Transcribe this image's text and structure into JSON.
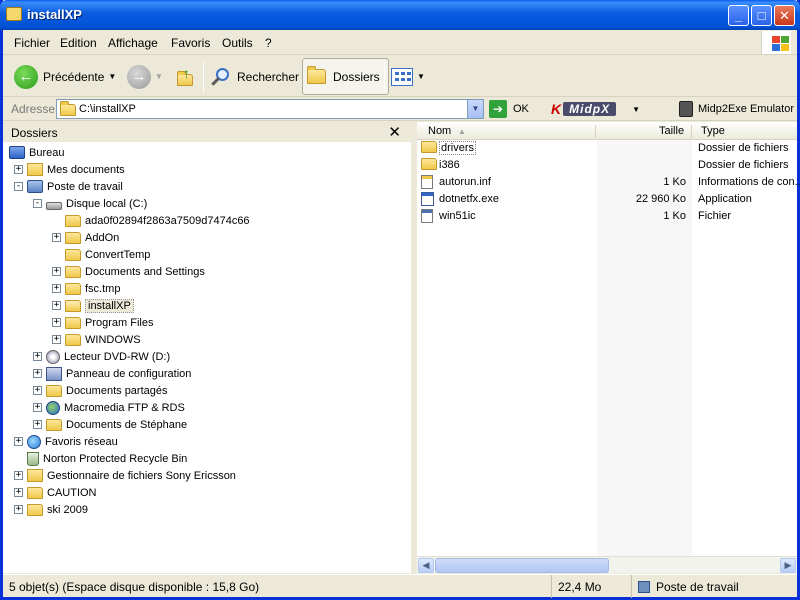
{
  "window": {
    "title": "installXP"
  },
  "menu": [
    "Fichier",
    "Edition",
    "Affichage",
    "Favoris",
    "Outils",
    "?"
  ],
  "toolbar": {
    "back": "Précédente",
    "search": "Rechercher",
    "folders": "Dossiers"
  },
  "address": {
    "label": "Adresse",
    "value": "C:\\installXP",
    "go": "OK",
    "plugin_logo": "MidpX",
    "plugin_emulator": "Midp2Exe Emulator"
  },
  "left_pane": {
    "header": "Dossiers",
    "tree": [
      {
        "label": "Bureau",
        "level": 0,
        "expander": "",
        "icon": "desktop-icon"
      },
      {
        "label": "Mes documents",
        "level": 1,
        "expander": "+",
        "icon": "my-documents-icon"
      },
      {
        "label": "Poste de travail",
        "level": 1,
        "expander": "-",
        "icon": "my-computer-icon"
      },
      {
        "label": "Disque local (C:)",
        "level": 2,
        "expander": "-",
        "icon": "hard-drive-icon"
      },
      {
        "label": "ada0f02894f2863a7509d7474c66",
        "level": 3,
        "expander": "",
        "icon": "folder-icon"
      },
      {
        "label": "AddOn",
        "level": 3,
        "expander": "+",
        "icon": "folder-icon"
      },
      {
        "label": "ConvertTemp",
        "level": 3,
        "expander": "",
        "icon": "folder-icon"
      },
      {
        "label": "Documents and Settings",
        "level": 3,
        "expander": "+",
        "icon": "folder-icon"
      },
      {
        "label": "fsc.tmp",
        "level": 3,
        "expander": "+",
        "icon": "folder-icon"
      },
      {
        "label": "installXP",
        "level": 3,
        "expander": "+",
        "icon": "folder-open-icon",
        "selected": true
      },
      {
        "label": "Program Files",
        "level": 3,
        "expander": "+",
        "icon": "folder-icon"
      },
      {
        "label": "WINDOWS",
        "level": 3,
        "expander": "+",
        "icon": "folder-icon"
      },
      {
        "label": "Lecteur DVD-RW (D:)",
        "level": 2,
        "expander": "+",
        "icon": "dvd-drive-icon"
      },
      {
        "label": "Panneau de configuration",
        "level": 2,
        "expander": "+",
        "icon": "control-panel-icon"
      },
      {
        "label": "Documents partagés",
        "level": 2,
        "expander": "+",
        "icon": "folder-icon"
      },
      {
        "label": "Macromedia FTP & RDS",
        "level": 2,
        "expander": "+",
        "icon": "ftp-globe-icon"
      },
      {
        "label": "Documents de Stéphane",
        "level": 2,
        "expander": "+",
        "icon": "folder-icon"
      },
      {
        "label": "Favoris réseau",
        "level": 1,
        "expander": "+",
        "icon": "network-icon"
      },
      {
        "label": "Norton Protected Recycle Bin",
        "level": 1,
        "expander": "",
        "icon": "recycle-bin-icon"
      },
      {
        "label": "Gestionnaire de fichiers Sony Ericsson",
        "level": 1,
        "expander": "+",
        "icon": "phone-manager-icon"
      },
      {
        "label": "CAUTION",
        "level": 1,
        "expander": "+",
        "icon": "folder-icon"
      },
      {
        "label": "ski 2009",
        "level": 1,
        "expander": "+",
        "icon": "folder-icon"
      }
    ]
  },
  "right_pane": {
    "columns": [
      "Nom",
      "Taille",
      "Type"
    ],
    "files": [
      {
        "name": "drivers",
        "size": "",
        "type": "Dossier de fichiers",
        "icon": "folder-icon"
      },
      {
        "name": "i386",
        "size": "",
        "type": "Dossier de fichiers",
        "icon": "folder-icon"
      },
      {
        "name": "autorun.inf",
        "size": "1 Ko",
        "type": "Informations de con...",
        "icon": "inf-file-icon"
      },
      {
        "name": "dotnetfx.exe",
        "size": "22 960 Ko",
        "type": "Application",
        "icon": "exe-file-icon"
      },
      {
        "name": "win51ic",
        "size": "1 Ko",
        "type": "Fichier",
        "icon": "generic-file-icon"
      }
    ]
  },
  "status": {
    "objects": "5 objet(s) (Espace disque disponible : 15,8 Go)",
    "size": "22,4 Mo",
    "location": "Poste de travail"
  },
  "colors": {
    "titlebar": "#0a5be0",
    "window_bg": "#ece9d8",
    "folder": "#f0c84a"
  }
}
